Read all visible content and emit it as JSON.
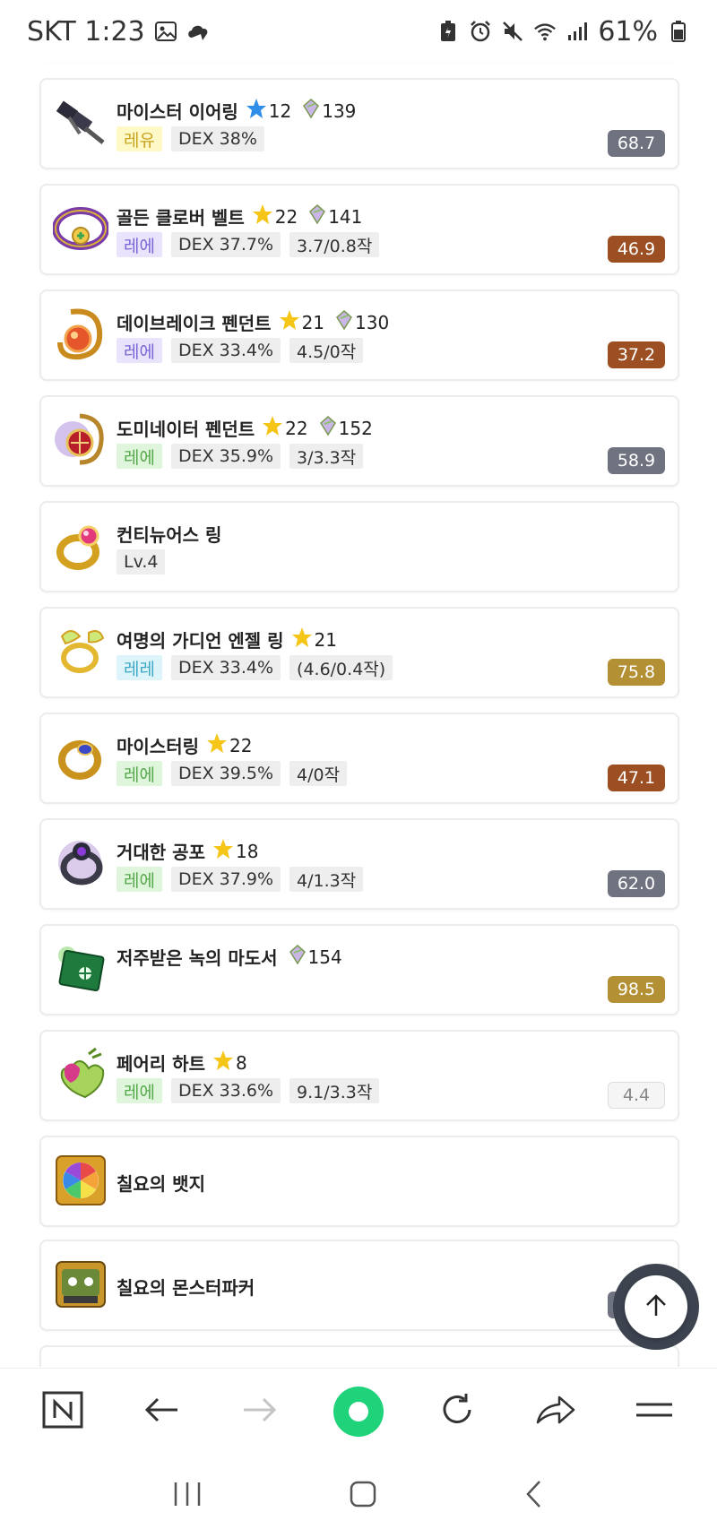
{
  "status_bar": {
    "carrier_time": "SKT 1:23",
    "battery": "61%"
  },
  "items": [
    {
      "name": "마이스터 이어링",
      "star_color": "#2f8fe8",
      "stars": "12",
      "soul": "139",
      "grade": "레유",
      "grade_type": "unique",
      "tags": [
        "DEX 38%"
      ],
      "score": "68.7",
      "score_type": "gray",
      "icon": "earring-icon"
    },
    {
      "name": "골든 클로버 벨트",
      "star_color": "#f5c518",
      "stars": "22",
      "soul": "141",
      "grade": "레에",
      "grade_type": "epic",
      "tags": [
        "DEX 37.7%",
        "3.7/0.8작"
      ],
      "score": "46.9",
      "score_type": "brown",
      "icon": "belt-icon"
    },
    {
      "name": "데이브레이크 펜던트",
      "star_color": "#f5c518",
      "stars": "21",
      "soul": "130",
      "grade": "레에",
      "grade_type": "epic",
      "tags": [
        "DEX 33.4%",
        "4.5/0작"
      ],
      "score": "37.2",
      "score_type": "brown",
      "icon": "pendant-icon"
    },
    {
      "name": "도미네이터 펜던트",
      "star_color": "#f5c518",
      "stars": "22",
      "soul": "152",
      "grade": "레에",
      "grade_type": "legend",
      "tags": [
        "DEX 35.9%",
        "3/3.3작"
      ],
      "score": "58.9",
      "score_type": "gray",
      "icon": "dominator-pendant-icon"
    },
    {
      "name": "컨티뉴어스 링",
      "stars": "",
      "soul": "",
      "grade": "",
      "tags": [
        "Lv.4"
      ],
      "score": "",
      "icon": "ring-icon"
    },
    {
      "name": "여명의 가디언 엔젤 링",
      "star_color": "#f5c518",
      "stars": "21",
      "soul": "",
      "grade": "레레",
      "grade_type": "cyan",
      "tags": [
        "DEX 33.4%",
        "(4.6/0.4작)"
      ],
      "score": "75.8",
      "score_type": "gold",
      "icon": "angel-ring-icon"
    },
    {
      "name": "마이스터링",
      "star_color": "#f5c518",
      "stars": "22",
      "soul": "",
      "grade": "레에",
      "grade_type": "legend",
      "tags": [
        "DEX 39.5%",
        "4/0작"
      ],
      "score": "47.1",
      "score_type": "brown",
      "icon": "meister-ring-icon"
    },
    {
      "name": "거대한 공포",
      "star_color": "#f5c518",
      "stars": "18",
      "soul": "",
      "grade": "레에",
      "grade_type": "legend",
      "tags": [
        "DEX 37.9%",
        "4/1.3작"
      ],
      "score": "62.0",
      "score_type": "gray",
      "icon": "eye-icon"
    },
    {
      "name": "저주받은 녹의 마도서",
      "stars": "",
      "soul": "154",
      "grade": "",
      "tags": [],
      "score": "98.5",
      "score_type": "gold",
      "icon": "book-icon"
    },
    {
      "name": "페어리 하트",
      "star_color": "#f5c518",
      "stars": "8",
      "soul": "",
      "grade": "레에",
      "grade_type": "legend",
      "tags": [
        "DEX 33.6%",
        "9.1/3.3작"
      ],
      "score": "4.4",
      "score_type": "light",
      "icon": "heart-icon"
    },
    {
      "name": "칠요의 뱃지",
      "stars": "",
      "soul": "",
      "grade": "",
      "tags": [],
      "score": "",
      "icon": "badge-icon"
    },
    {
      "name": "칠요의 몬스터파커",
      "stars": "",
      "soul": "",
      "grade": "",
      "tags": [],
      "score": "57",
      "score_type": "gray",
      "icon": "monster-parker-icon"
    }
  ]
}
